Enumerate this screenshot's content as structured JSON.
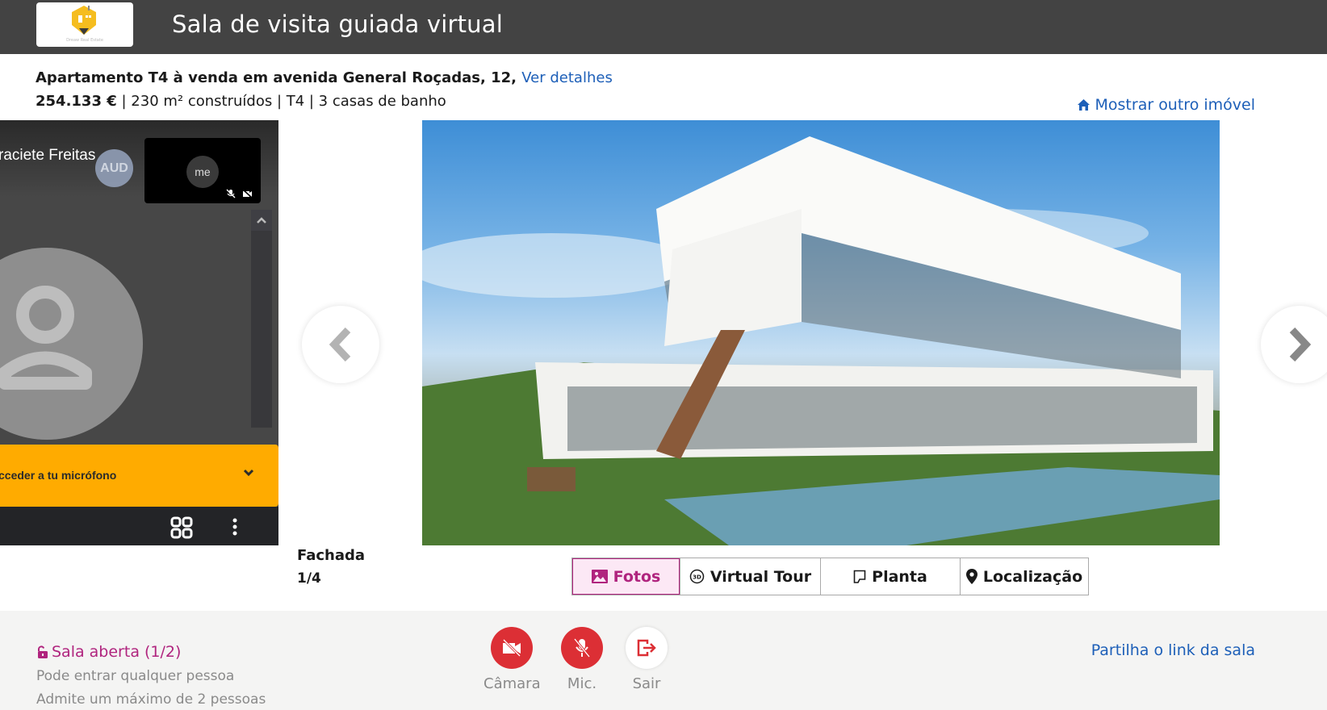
{
  "header": {
    "logo_caption": "Dreaw Real Estate",
    "title": "Sala de visita guiada virtual"
  },
  "listing": {
    "title": "Apartamento T4 à venda em avenida General Roçadas, 12, ",
    "details_link": "Ver detalhes",
    "price": "254.133 €",
    "specs": " | 230 m² construídos | T4 | 3 casas de banho",
    "other_property_link": "Mostrar outro imóvel"
  },
  "video": {
    "remote_participant_name": "raciete Freitas",
    "remote_badge": "AUD",
    "self_label": "me",
    "mic_banner_text": "cceder a tu micrófono"
  },
  "gallery": {
    "caption_title": "Fachada",
    "counter": "1/4",
    "tabs": [
      {
        "label": "Fotos",
        "icon": "image-icon",
        "active": true
      },
      {
        "label": "Virtual Tour",
        "icon": "3d-icon",
        "active": false
      },
      {
        "label": "Planta",
        "icon": "floorplan-icon",
        "active": false
      },
      {
        "label": "Localização",
        "icon": "map-pin-icon",
        "active": false
      }
    ]
  },
  "room": {
    "status_title": "Sala aberta (1/2)",
    "status_line1": "Pode entrar qualquer pessoa",
    "status_line2": "Admite um máximo de 2 pessoas",
    "controls": [
      {
        "label": "Câmara",
        "icon": "camera-off-icon"
      },
      {
        "label": "Mic.",
        "icon": "mic-off-icon"
      },
      {
        "label": "Sair",
        "icon": "exit-icon"
      }
    ],
    "share_link": "Partilha o link da sala"
  },
  "colors": {
    "header_bg": "#434343",
    "link_blue": "#1d5fb8",
    "accent_magenta": "#b0247e",
    "control_red": "#dc2f35",
    "banner_amber": "#ffab00"
  }
}
